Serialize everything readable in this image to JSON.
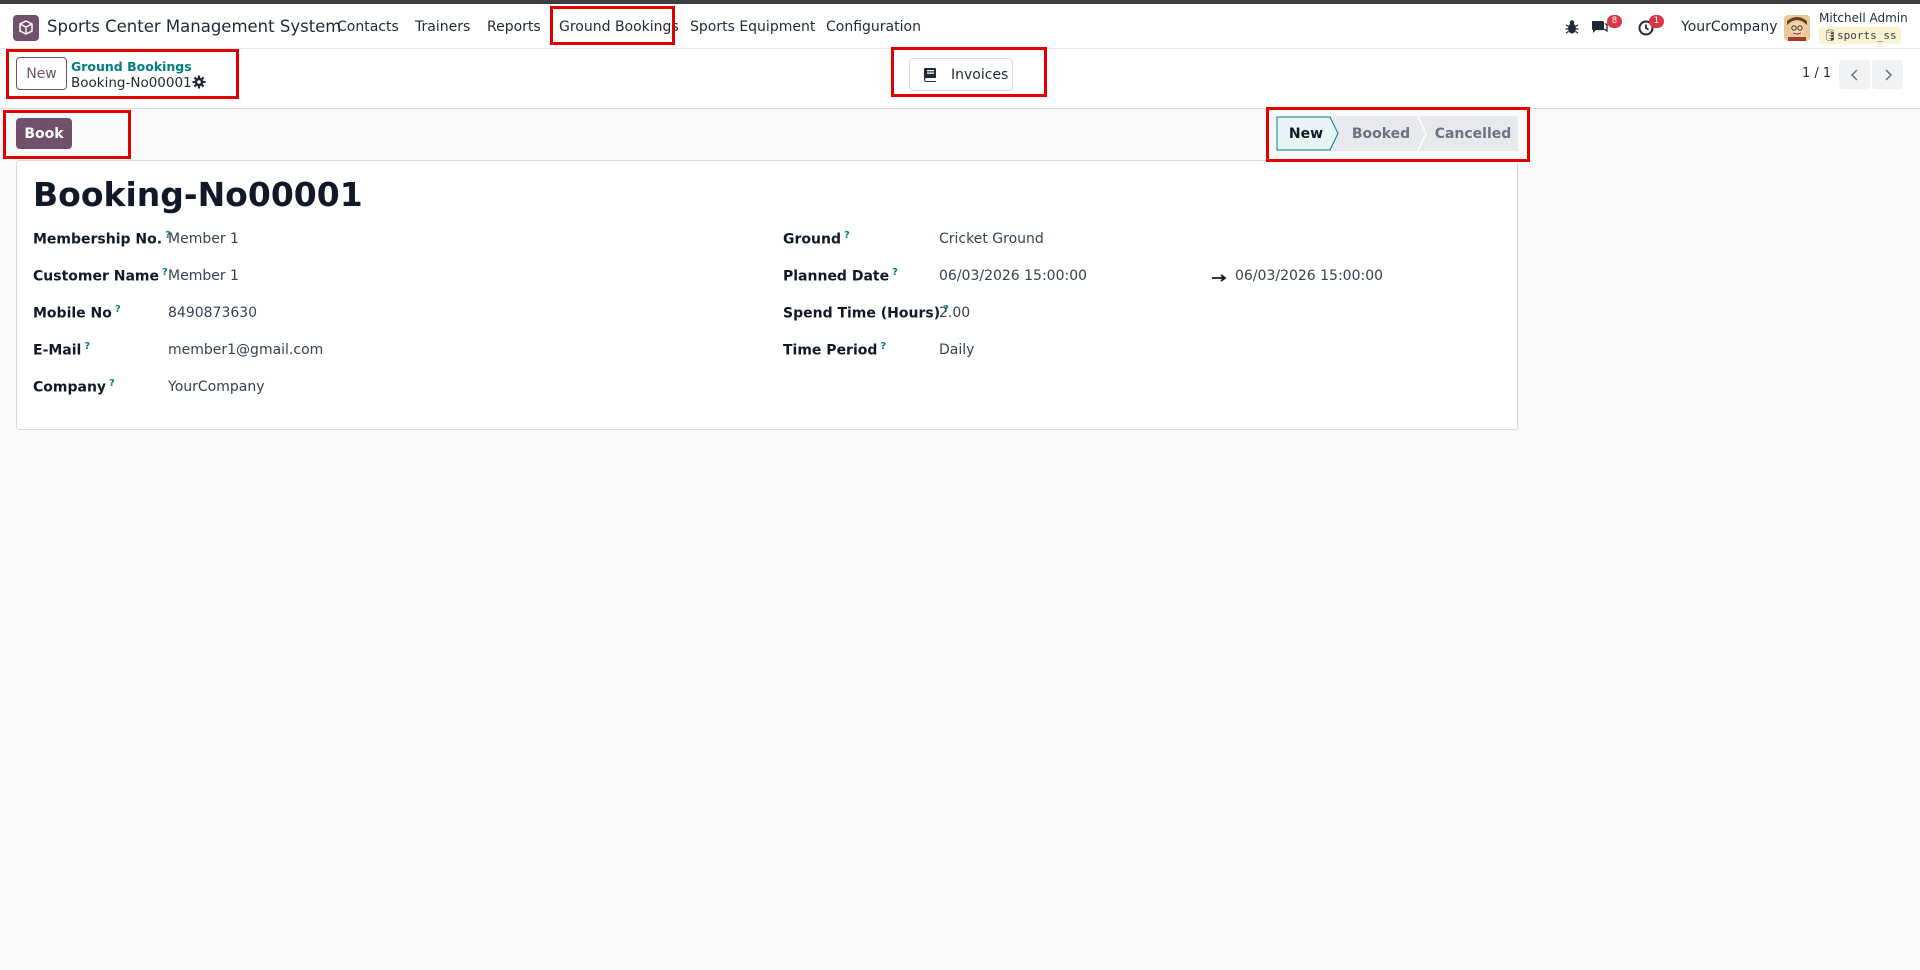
{
  "navbar": {
    "app_name": "Sports Center Management System",
    "menu": [
      "Contacts",
      "Trainers",
      "Reports",
      "Ground Bookings",
      "Sports Equipment",
      "Configuration"
    ],
    "messages_count": "8",
    "activities_count": "1",
    "company": "YourCompany",
    "user_name": "Mitchell Admin",
    "database": "sports_ss"
  },
  "control_panel": {
    "new_label": "New",
    "breadcrumb_parent": "Ground Bookings",
    "breadcrumb_current": "Booking-No00001",
    "invoices_label": "Invoices",
    "pager": "1 / 1"
  },
  "statusbar": {
    "book_label": "Book",
    "steps": [
      "New",
      "Booked",
      "Cancelled"
    ],
    "active_step": "New"
  },
  "form": {
    "title": "Booking-No00001",
    "left": [
      {
        "label": "Membership No.",
        "value": "Member 1"
      },
      {
        "label": "Customer Name",
        "value": "Member 1"
      },
      {
        "label": "Mobile No",
        "value": "8490873630"
      },
      {
        "label": "E-Mail",
        "value": "member1@gmail.com"
      },
      {
        "label": "Company",
        "value": "YourCompany"
      }
    ],
    "right": [
      {
        "label": "Ground",
        "value": "Cricket Ground"
      },
      {
        "label": "Planned Date",
        "value": "06/03/2026 15:00:00",
        "value_end": "06/03/2026 15:00:00"
      },
      {
        "label": "Spend Time (Hours)",
        "value": "2.00"
      },
      {
        "label": "Time Period",
        "value": "Daily"
      }
    ],
    "help_marker": "?"
  },
  "colors": {
    "brand": "#71506b",
    "link": "#017e84",
    "highlight": "#e00000",
    "badge": "#dc3545"
  }
}
